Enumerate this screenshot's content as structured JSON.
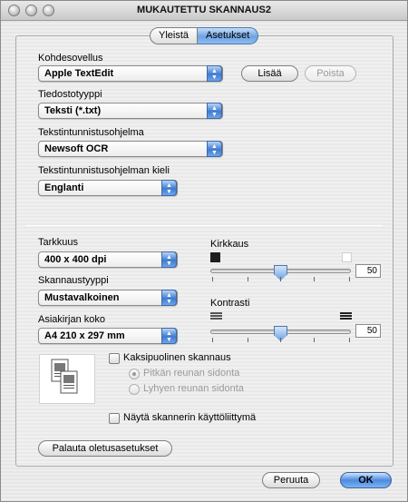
{
  "window": {
    "title": "MUKAUTETTU SKANNAUS2"
  },
  "tabs": [
    {
      "label": "Yleistä"
    },
    {
      "label": "Asetukset"
    }
  ],
  "app": {
    "label": "Kohdesovellus",
    "value": "Apple TextEdit",
    "add_label": "Lisää",
    "remove_label": "Poista"
  },
  "file_type": {
    "label": "Tiedostotyyppi",
    "value": "Teksti (*.txt)"
  },
  "ocr": {
    "label": "Tekstintunnistusohjelma",
    "value": "Newsoft OCR"
  },
  "ocr_language": {
    "label": "Tekstintunnistusohjelman kieli",
    "value": "Englanti"
  },
  "resolution": {
    "label": "Tarkkuus",
    "value": "400 x 400 dpi"
  },
  "scan_type": {
    "label": "Skannaustyyppi",
    "value": "Mustavalkoinen"
  },
  "doc_size": {
    "label": "Asiakirjan koko",
    "value": "A4  210 x 297 mm"
  },
  "brightness": {
    "label": "Kirkkaus",
    "value": "50",
    "fraction": 0.5
  },
  "contrast": {
    "label": "Kontrasti",
    "value": "50",
    "fraction": 0.5
  },
  "duplex": {
    "label": "Kaksipuolinen skannaus",
    "long_edge": "Pitkän reunan sidonta",
    "short_edge": "Lyhyen reunan sidonta"
  },
  "show_ui": {
    "label": "Näytä skannerin käyttöliittymä"
  },
  "reset_label": "Palauta oletusasetukset",
  "cancel_label": "Peruuta",
  "ok_label": "OK"
}
